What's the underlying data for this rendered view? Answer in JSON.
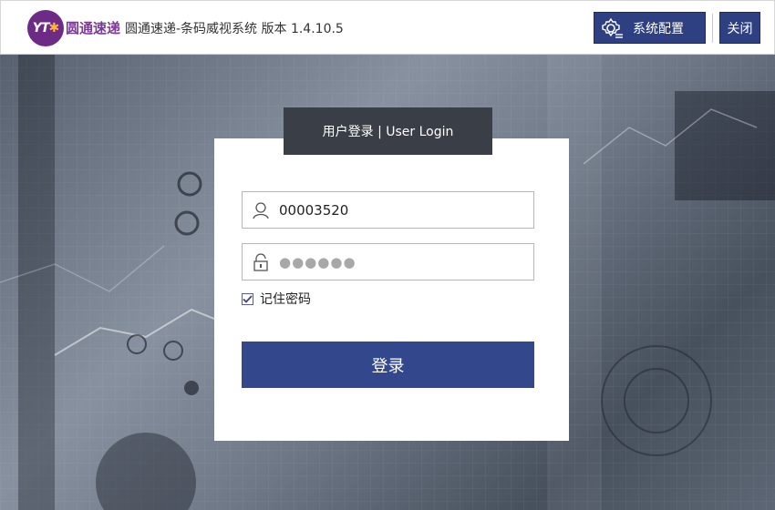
{
  "window": {
    "brand_cn": "圆通速递",
    "title": "圆通速递-条码威视系统 版本 1.4.10.5",
    "logo_text": "YT",
    "config_label": "系统配置",
    "close_label": "关闭"
  },
  "login": {
    "tab_label": "用户登录 | User Login",
    "username": "00003520",
    "password_mask": "●●●●●●",
    "remember_label": "记住密码",
    "remember_checked": true,
    "submit_label": "登录"
  },
  "colors": {
    "accent": "#33478c",
    "brand": "#6d2a86",
    "tab_bg": "#3a3e47"
  },
  "icons": {
    "config": "gear-icon",
    "username": "user-icon",
    "password": "lock-icon",
    "remember": "checkbox-checked-icon"
  }
}
